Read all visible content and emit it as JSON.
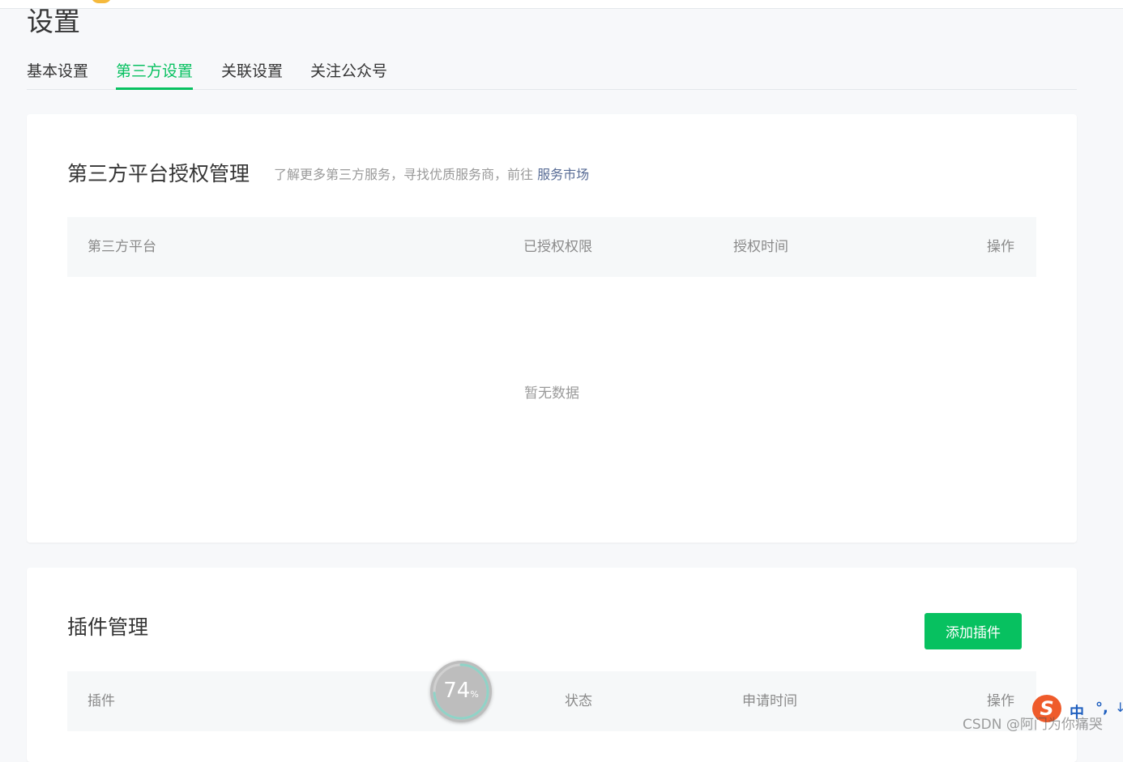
{
  "page": {
    "title": "设置"
  },
  "tabs": [
    {
      "label": "基本设置",
      "active": false
    },
    {
      "label": "第三方设置",
      "active": true
    },
    {
      "label": "关联设置",
      "active": false
    },
    {
      "label": "关注公众号",
      "active": false
    }
  ],
  "third_party": {
    "title": "第三方平台授权管理",
    "desc": "了解更多第三方服务，寻找优质服务商，前往",
    "market_link": "服务市场",
    "columns": [
      "第三方平台",
      "已授权权限",
      "授权时间",
      "操作"
    ],
    "empty_text": "暂无数据"
  },
  "plugins": {
    "title": "插件管理",
    "add_button": "添加插件",
    "columns": [
      "插件",
      "状态",
      "申请时间",
      "操作"
    ]
  },
  "progress_widget": {
    "value": "74",
    "unit": "%",
    "fraction": 0.74
  },
  "ime": {
    "logo": "S",
    "lang": "中",
    "punct": "°,",
    "more": "↓"
  },
  "watermark": "CSDN @阿门为你痛哭",
  "colors": {
    "accent": "#07c160",
    "link": "#576b95",
    "background": "#f7f8fa"
  }
}
